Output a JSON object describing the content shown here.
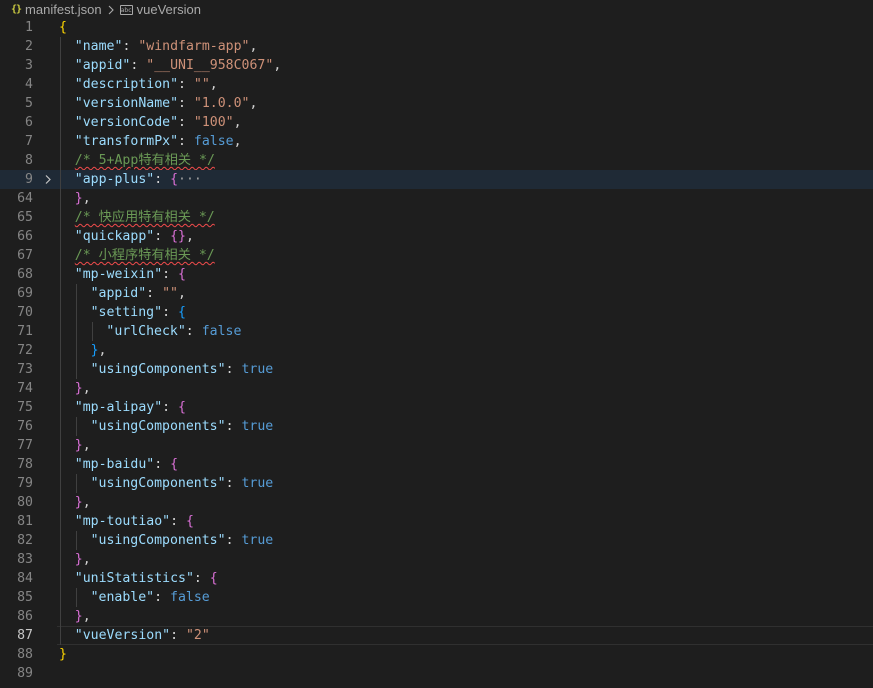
{
  "breadcrumb": {
    "file_icon": "{}",
    "file_name": "manifest.json",
    "separator_icon": "chevron-right-icon",
    "symbol_icon": "abc",
    "symbol_name": "vueVersion"
  },
  "colors": {
    "background": "#1e1e1e",
    "key": "#9cdcfe",
    "string": "#ce9178",
    "keyword": "#569cd6",
    "comment": "#6a9955",
    "bracket_level1": "#ffd700",
    "bracket_level2": "#da70d6",
    "bracket_level3": "#179fff",
    "line_number": "#858585"
  },
  "editor": {
    "lines": [
      {
        "n": "1",
        "indent": 0,
        "tokens": [
          {
            "t": "{",
            "c": "b1"
          }
        ]
      },
      {
        "n": "2",
        "indent": 1,
        "tokens": [
          {
            "t": "\"name\"",
            "c": "key"
          },
          {
            "t": ": ",
            "c": "p"
          },
          {
            "t": "\"windfarm-app\"",
            "c": "str"
          },
          {
            "t": ",",
            "c": "p"
          }
        ]
      },
      {
        "n": "3",
        "indent": 1,
        "tokens": [
          {
            "t": "\"appid\"",
            "c": "key"
          },
          {
            "t": ": ",
            "c": "p"
          },
          {
            "t": "\"__UNI__958C067\"",
            "c": "str"
          },
          {
            "t": ",",
            "c": "p"
          }
        ]
      },
      {
        "n": "4",
        "indent": 1,
        "tokens": [
          {
            "t": "\"description\"",
            "c": "key"
          },
          {
            "t": ": ",
            "c": "p"
          },
          {
            "t": "\"\"",
            "c": "str"
          },
          {
            "t": ",",
            "c": "p"
          }
        ]
      },
      {
        "n": "5",
        "indent": 1,
        "tokens": [
          {
            "t": "\"versionName\"",
            "c": "key"
          },
          {
            "t": ": ",
            "c": "p"
          },
          {
            "t": "\"1.0.0\"",
            "c": "str"
          },
          {
            "t": ",",
            "c": "p"
          }
        ]
      },
      {
        "n": "6",
        "indent": 1,
        "tokens": [
          {
            "t": "\"versionCode\"",
            "c": "key"
          },
          {
            "t": ": ",
            "c": "p"
          },
          {
            "t": "\"100\"",
            "c": "str"
          },
          {
            "t": ",",
            "c": "p"
          }
        ]
      },
      {
        "n": "7",
        "indent": 1,
        "tokens": [
          {
            "t": "\"transformPx\"",
            "c": "key"
          },
          {
            "t": ": ",
            "c": "p"
          },
          {
            "t": "false",
            "c": "kw"
          },
          {
            "t": ",",
            "c": "p"
          }
        ]
      },
      {
        "n": "8",
        "indent": 1,
        "tokens": [
          {
            "t": "/* 5+App特有相关 */",
            "c": "com",
            "squig": true
          }
        ]
      },
      {
        "n": "9",
        "indent": 1,
        "fold": true,
        "highlight": true,
        "tokens": [
          {
            "t": "\"app-plus\"",
            "c": "key"
          },
          {
            "t": ": ",
            "c": "p"
          },
          {
            "t": "{",
            "c": "b2"
          },
          {
            "t": "···",
            "c": "dots"
          }
        ]
      },
      {
        "n": "64",
        "indent": 1,
        "tokens": [
          {
            "t": "}",
            "c": "b2"
          },
          {
            "t": ",",
            "c": "p"
          }
        ]
      },
      {
        "n": "65",
        "indent": 1,
        "tokens": [
          {
            "t": "/* 快应用特有相关 */",
            "c": "com",
            "squig": true
          }
        ]
      },
      {
        "n": "66",
        "indent": 1,
        "tokens": [
          {
            "t": "\"quickapp\"",
            "c": "key"
          },
          {
            "t": ": ",
            "c": "p"
          },
          {
            "t": "{}",
            "c": "b2"
          },
          {
            "t": ",",
            "c": "p"
          }
        ]
      },
      {
        "n": "67",
        "indent": 1,
        "tokens": [
          {
            "t": "/* 小程序特有相关 */",
            "c": "com",
            "squig": true
          }
        ]
      },
      {
        "n": "68",
        "indent": 1,
        "tokens": [
          {
            "t": "\"mp-weixin\"",
            "c": "key"
          },
          {
            "t": ": ",
            "c": "p"
          },
          {
            "t": "{",
            "c": "b2"
          }
        ]
      },
      {
        "n": "69",
        "indent": 2,
        "tokens": [
          {
            "t": "\"appid\"",
            "c": "key"
          },
          {
            "t": ": ",
            "c": "p"
          },
          {
            "t": "\"\"",
            "c": "str"
          },
          {
            "t": ",",
            "c": "p"
          }
        ]
      },
      {
        "n": "70",
        "indent": 2,
        "tokens": [
          {
            "t": "\"setting\"",
            "c": "key"
          },
          {
            "t": ": ",
            "c": "p"
          },
          {
            "t": "{",
            "c": "b3"
          }
        ]
      },
      {
        "n": "71",
        "indent": 3,
        "tokens": [
          {
            "t": "\"urlCheck\"",
            "c": "key"
          },
          {
            "t": ": ",
            "c": "p"
          },
          {
            "t": "false",
            "c": "kw"
          }
        ]
      },
      {
        "n": "72",
        "indent": 2,
        "tokens": [
          {
            "t": "}",
            "c": "b3"
          },
          {
            "t": ",",
            "c": "p"
          }
        ]
      },
      {
        "n": "73",
        "indent": 2,
        "tokens": [
          {
            "t": "\"usingComponents\"",
            "c": "key"
          },
          {
            "t": ": ",
            "c": "p"
          },
          {
            "t": "true",
            "c": "kw"
          }
        ]
      },
      {
        "n": "74",
        "indent": 1,
        "tokens": [
          {
            "t": "}",
            "c": "b2"
          },
          {
            "t": ",",
            "c": "p"
          }
        ]
      },
      {
        "n": "75",
        "indent": 1,
        "tokens": [
          {
            "t": "\"mp-alipay\"",
            "c": "key"
          },
          {
            "t": ": ",
            "c": "p"
          },
          {
            "t": "{",
            "c": "b2"
          }
        ]
      },
      {
        "n": "76",
        "indent": 2,
        "tokens": [
          {
            "t": "\"usingComponents\"",
            "c": "key"
          },
          {
            "t": ": ",
            "c": "p"
          },
          {
            "t": "true",
            "c": "kw"
          }
        ]
      },
      {
        "n": "77",
        "indent": 1,
        "tokens": [
          {
            "t": "}",
            "c": "b2"
          },
          {
            "t": ",",
            "c": "p"
          }
        ]
      },
      {
        "n": "78",
        "indent": 1,
        "tokens": [
          {
            "t": "\"mp-baidu\"",
            "c": "key"
          },
          {
            "t": ": ",
            "c": "p"
          },
          {
            "t": "{",
            "c": "b2"
          }
        ]
      },
      {
        "n": "79",
        "indent": 2,
        "tokens": [
          {
            "t": "\"usingComponents\"",
            "c": "key"
          },
          {
            "t": ": ",
            "c": "p"
          },
          {
            "t": "true",
            "c": "kw"
          }
        ]
      },
      {
        "n": "80",
        "indent": 1,
        "tokens": [
          {
            "t": "}",
            "c": "b2"
          },
          {
            "t": ",",
            "c": "p"
          }
        ]
      },
      {
        "n": "81",
        "indent": 1,
        "tokens": [
          {
            "t": "\"mp-toutiao\"",
            "c": "key"
          },
          {
            "t": ": ",
            "c": "p"
          },
          {
            "t": "{",
            "c": "b2"
          }
        ]
      },
      {
        "n": "82",
        "indent": 2,
        "tokens": [
          {
            "t": "\"usingComponents\"",
            "c": "key"
          },
          {
            "t": ": ",
            "c": "p"
          },
          {
            "t": "true",
            "c": "kw"
          }
        ]
      },
      {
        "n": "83",
        "indent": 1,
        "tokens": [
          {
            "t": "}",
            "c": "b2"
          },
          {
            "t": ",",
            "c": "p"
          }
        ]
      },
      {
        "n": "84",
        "indent": 1,
        "tokens": [
          {
            "t": "\"uniStatistics\"",
            "c": "key"
          },
          {
            "t": ": ",
            "c": "p"
          },
          {
            "t": "{",
            "c": "b2"
          }
        ]
      },
      {
        "n": "85",
        "indent": 2,
        "tokens": [
          {
            "t": "\"enable\"",
            "c": "key"
          },
          {
            "t": ": ",
            "c": "p"
          },
          {
            "t": "false",
            "c": "kw"
          }
        ]
      },
      {
        "n": "86",
        "indent": 1,
        "tokens": [
          {
            "t": "}",
            "c": "b2"
          },
          {
            "t": ",",
            "c": "p"
          }
        ]
      },
      {
        "n": "87",
        "indent": 1,
        "active": true,
        "tokens": [
          {
            "t": "\"vueVersion\"",
            "c": "key"
          },
          {
            "t": ": ",
            "c": "p"
          },
          {
            "t": "\"2\"",
            "c": "str"
          }
        ]
      },
      {
        "n": "88",
        "indent": 0,
        "tokens": [
          {
            "t": "}",
            "c": "b1"
          }
        ]
      },
      {
        "n": "89",
        "indent": 0,
        "tokens": []
      }
    ]
  }
}
